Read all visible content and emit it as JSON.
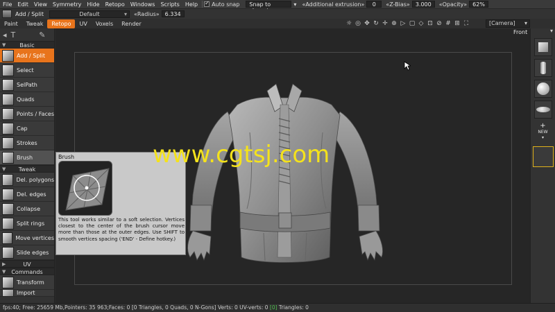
{
  "menubar": {
    "items": [
      "File",
      "Edit",
      "View",
      "Symmetry",
      "Hide",
      "Retopo",
      "Windows",
      "Scripts",
      "Help"
    ],
    "auto_snap_label": "Auto snap",
    "snap_mode": "Snap to closest",
    "additional_extrusion_label": "«Additional extrusion»",
    "additional_extrusion_value": "0",
    "zbias_label": "«Z-Bias»",
    "zbias_value": "3.000",
    "opacity_label": "«Opacity»",
    "opacity_value": "62%"
  },
  "toolbar2": {
    "tool_name": "Add / Split",
    "preset": "Default",
    "radius_label": "«Radius»",
    "radius_value": "6.334"
  },
  "tabs": [
    {
      "label": "Paint",
      "active": false
    },
    {
      "label": "Tweak",
      "active": false
    },
    {
      "label": "Retopo",
      "active": true
    },
    {
      "label": "UV",
      "active": false
    },
    {
      "label": "Voxels",
      "active": false
    },
    {
      "label": "Render",
      "active": false
    }
  ],
  "viewport": {
    "camera": "[Camera]",
    "view_label": "Front"
  },
  "left_panel": {
    "section_basic": "Basic",
    "section_tweak": "Tweak",
    "section_uv": "UV",
    "section_commands": "Commands",
    "basic_tools": [
      "Add / Split",
      "Select",
      "SelPath",
      "Quads",
      "Points / Faces",
      "Cap",
      "Strokes",
      "Brush"
    ],
    "tweak_tools": [
      "Del. polygons",
      "Del. edges",
      "Collapse",
      "Split rings",
      "Move vertices",
      "Slide edges"
    ],
    "command_tools": [
      "Transform",
      "Import"
    ]
  },
  "tooltip": {
    "title": "Brush",
    "text": "This tool works similar to a soft selection. Vertices closest to the center of the brush cursor move more than those at the outer edges. Use SHIFT to smooth vertices spacing ('END' - Define hotkey.)"
  },
  "right_panel": {
    "new_label": "NEW"
  },
  "watermark": "www.cgtsj.com",
  "statusbar": {
    "part1": "fps:40;    Free: 25659 Mb,Pointers: 35 963;Faces: 0 [0 Triangles, 0 Quads, 0 N-Gons] Verts: 0    UV-verts: 0 ",
    "green": "[0]",
    "part2": " Triangles: 0"
  }
}
